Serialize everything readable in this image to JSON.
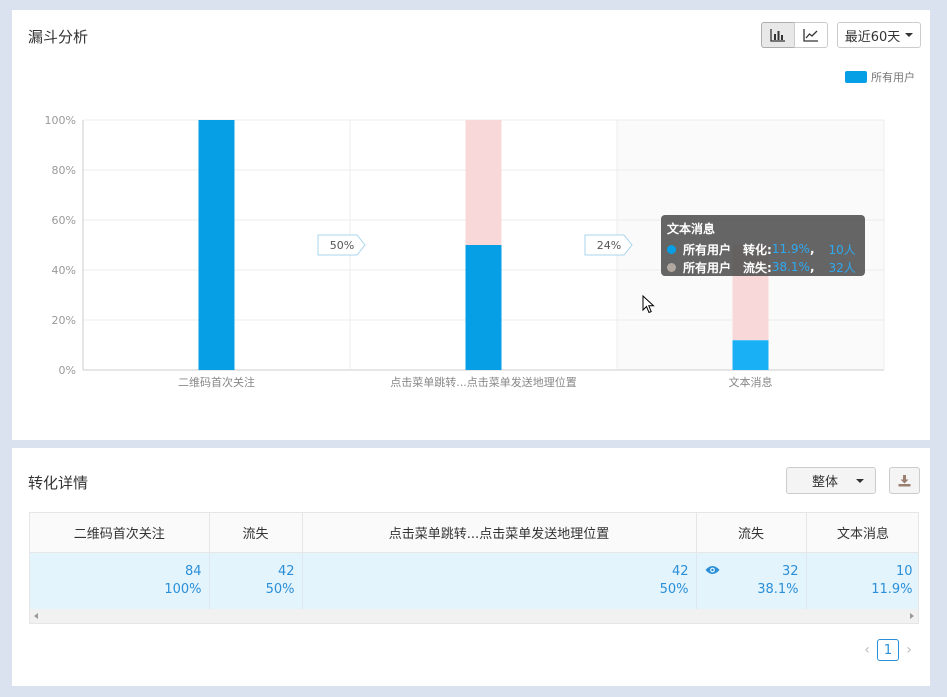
{
  "funnel": {
    "title": "漏斗分析",
    "range_label": "最近60天",
    "legend_label": "所有用户",
    "chart_data": {
      "type": "bar",
      "categories": [
        "二维码首次关注",
        "点击菜单跳转...点击菜单发送地理位置",
        "文本消息"
      ],
      "series": [
        {
          "name": "所有用户",
          "values": [
            100,
            50,
            11.9
          ]
        }
      ],
      "lost": [
        0,
        50,
        38.1
      ],
      "conversion_labels": [
        "50%",
        "24%"
      ],
      "ylim": [
        0,
        100
      ],
      "yticks": [
        "0%",
        "20%",
        "40%",
        "60%",
        "80%",
        "100%"
      ],
      "colors": {
        "converted": "#069fe6",
        "converted_hover": "#1ab0f5",
        "lost": "#f8d8d8",
        "tooltip_value": "#2ea9f0"
      },
      "grid": true,
      "legend": "top-right"
    },
    "tooltip": {
      "title": "文本消息",
      "rows": [
        {
          "series": "所有用户",
          "metric": "转化:",
          "percent": "11.9%",
          "count": "10人",
          "color": "#069fe6"
        },
        {
          "series": "所有用户",
          "metric": "流失:",
          "percent": "38.1%",
          "count": "32人",
          "color": "#b3a89f"
        }
      ]
    }
  },
  "details": {
    "title": "转化详情",
    "scope_label": "整体",
    "columns": [
      "二维码首次关注",
      "流失",
      "点击菜单跳转...点击菜单发送地理位置",
      "流失",
      "文本消息"
    ],
    "row": [
      {
        "count": "84",
        "percent": "100%"
      },
      {
        "count": "42",
        "percent": "50%"
      },
      {
        "count": "42",
        "percent": "50%"
      },
      {
        "count": "32",
        "percent": "38.1%"
      },
      {
        "count": "10",
        "percent": "11.9%"
      }
    ],
    "page": "1"
  }
}
